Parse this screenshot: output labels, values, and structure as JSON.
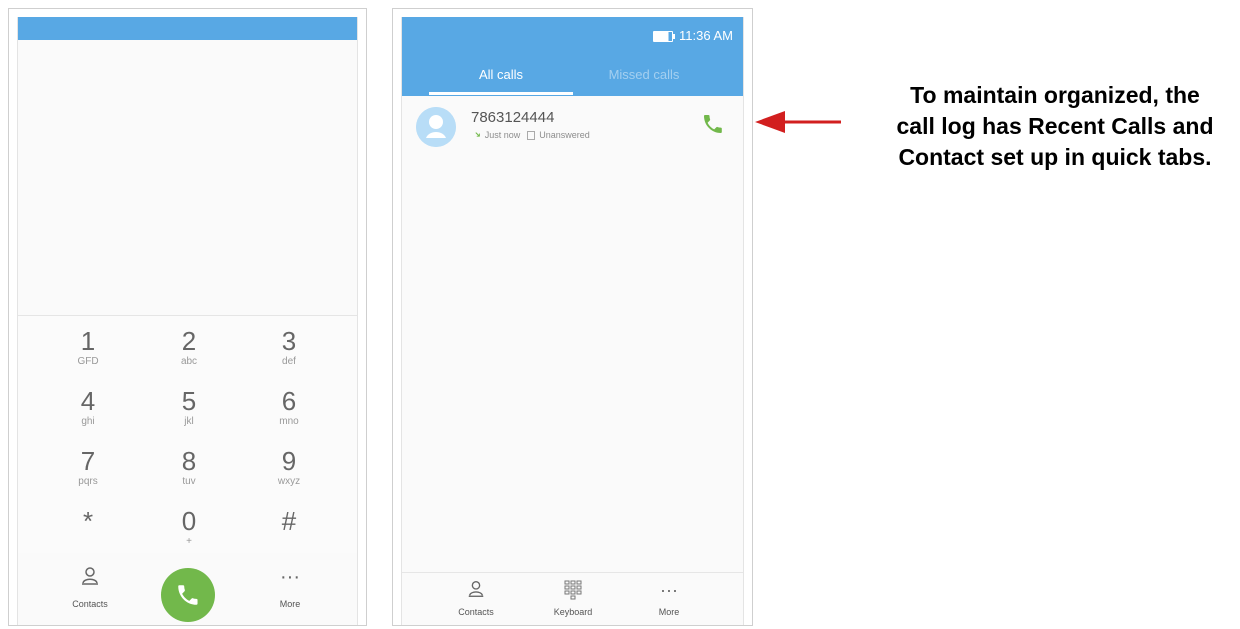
{
  "left_phone": {
    "dialpad": [
      {
        "num": "1",
        "letters": "GFD"
      },
      {
        "num": "2",
        "letters": "abc"
      },
      {
        "num": "3",
        "letters": "def"
      },
      {
        "num": "4",
        "letters": "ghi"
      },
      {
        "num": "5",
        "letters": "jkl"
      },
      {
        "num": "6",
        "letters": "mno"
      },
      {
        "num": "7",
        "letters": "pqrs"
      },
      {
        "num": "8",
        "letters": "tuv"
      },
      {
        "num": "9",
        "letters": "wxyz"
      },
      {
        "num": "*",
        "letters": ""
      },
      {
        "num": "0",
        "letters": "+"
      },
      {
        "num": "#",
        "letters": ""
      }
    ],
    "bottom_actions": {
      "contacts_label": "Contacts",
      "more_label": "More",
      "more_icon": "more-dots-icon",
      "contacts_icon": "contacts-icon",
      "call_icon": "phone-icon"
    },
    "header_color": "#58a8e4",
    "call_button_color": "#72b84b"
  },
  "right_phone": {
    "status": {
      "time": "11:36 AM"
    },
    "tabs": {
      "all_calls": "All calls",
      "missed_calls": "Missed calls"
    },
    "call_log": [
      {
        "number": "7863124444",
        "meta_time": "Just now",
        "meta_status": "Unanswered"
      }
    ],
    "bottom_actions": {
      "contacts_label": "Contacts",
      "keyboard_label": "Keyboard",
      "more_label": "More",
      "contacts_icon": "contacts-icon",
      "keyboard_icon": "dialpad-icon",
      "more_icon": "more-dots-icon"
    },
    "header_color": "#58a8e4",
    "call_icon_color": "#72b84b"
  },
  "annotation": {
    "line1": "To maintain organized, the",
    "line2": "call log has Recent Calls and",
    "line3": "Contact set up in quick tabs.",
    "arrow_color": "#d21f1f"
  }
}
